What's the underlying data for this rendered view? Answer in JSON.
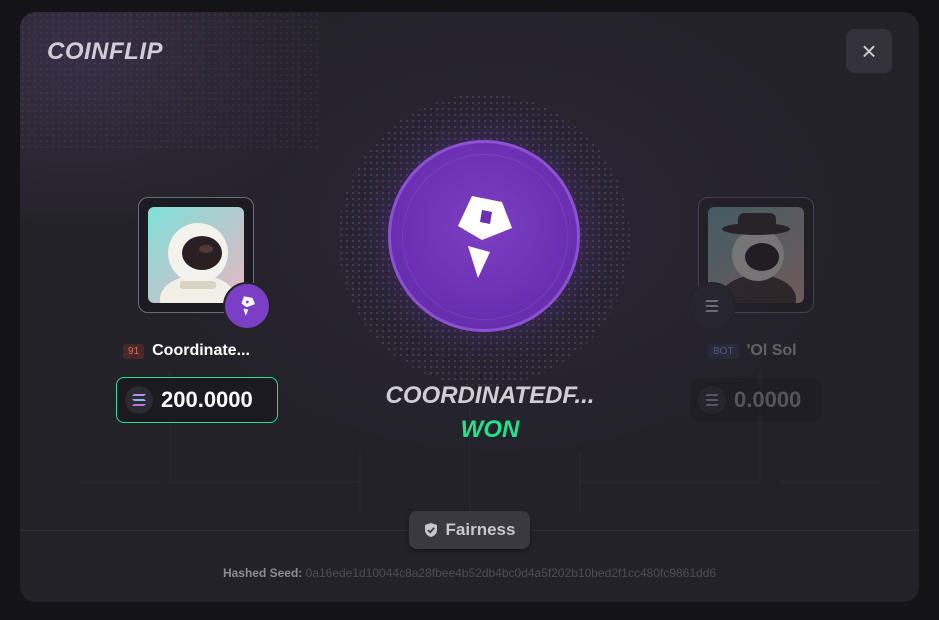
{
  "modal": {
    "title": "COINFLIP",
    "close_icon": "×"
  },
  "player_left": {
    "level": "91",
    "name": "Coordinate...",
    "amount": "200.0000",
    "avatar": "astronaut-avatar",
    "coin_icon": "brand-logo-icon",
    "accent": "#25e08d"
  },
  "player_right": {
    "level": "BOT",
    "name": "'Ol Sol",
    "amount": "0.0000",
    "avatar": "cowboy-astronaut-avatar",
    "coin_icon": "solana-icon"
  },
  "result": {
    "winner_name": "COORDINATEDF...",
    "status": "WON",
    "coin_color": "#6a2fb2",
    "won_color": "#25e08d"
  },
  "fairness": {
    "label": "Fairness",
    "icon": "shield-check-icon"
  },
  "seed": {
    "label": "Hashed Seed:",
    "value": "0a16ede1d10044c8a28fbee4b52db4bc0d4a5f202b10bed2f1cc480fc9861dd6"
  }
}
